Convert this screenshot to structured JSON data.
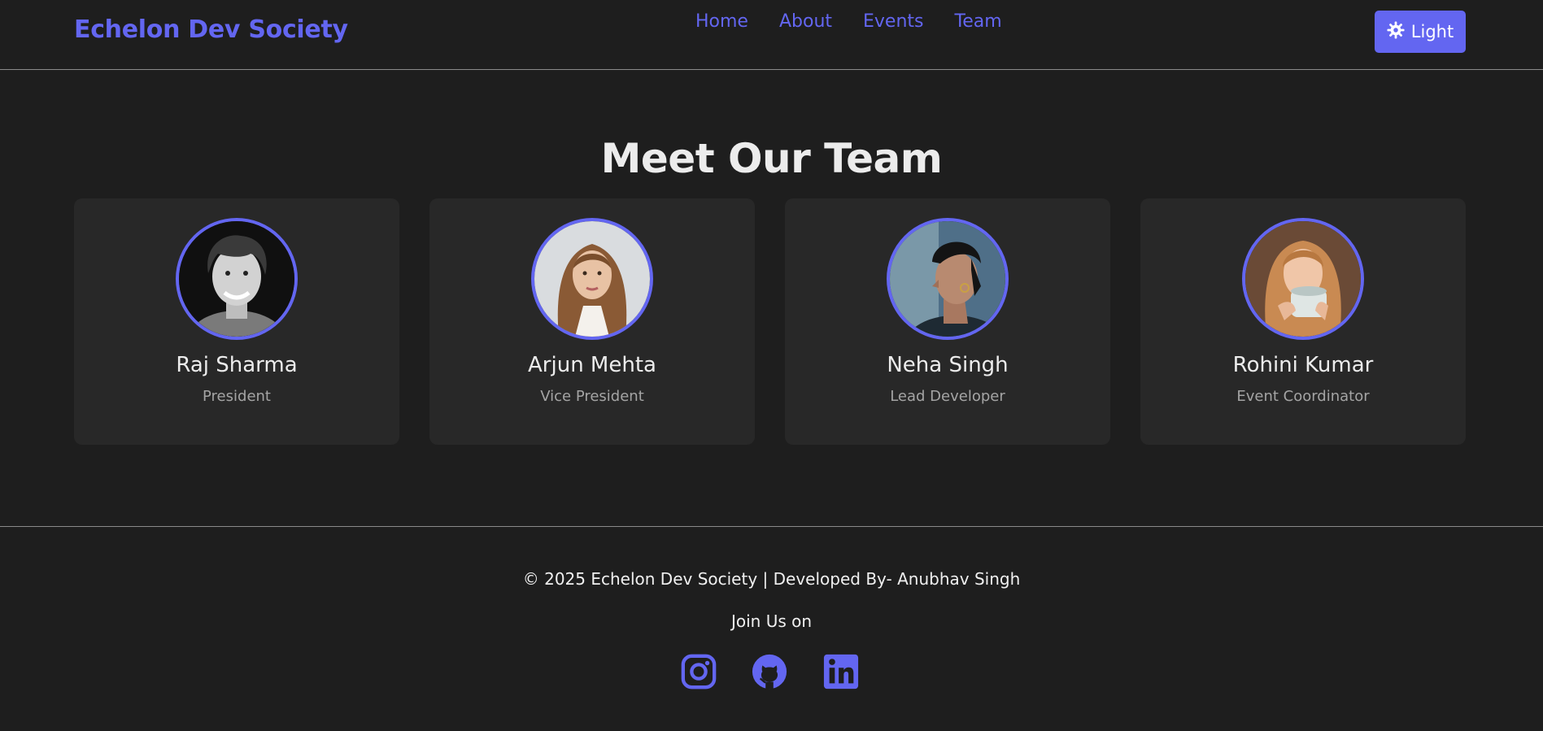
{
  "header": {
    "brand": "Echelon Dev Society",
    "nav": [
      "Home",
      "About",
      "Events",
      "Team"
    ],
    "theme_toggle": {
      "label": "Light",
      "icon": "sun-icon"
    }
  },
  "section": {
    "title": "Meet Our Team"
  },
  "team": [
    {
      "name": "Raj Sharma",
      "role": "President"
    },
    {
      "name": "Arjun Mehta",
      "role": "Vice President"
    },
    {
      "name": "Neha Singh",
      "role": "Lead Developer"
    },
    {
      "name": "Rohini Kumar",
      "role": "Event Coordinator"
    }
  ],
  "footer": {
    "copyright": "© 2025 Echelon Dev Society | Developed By- Anubhav Singh",
    "join_text": "Join Us on",
    "socials": [
      "instagram-icon",
      "github-icon",
      "linkedin-icon"
    ]
  },
  "colors": {
    "accent": "#6366f1",
    "background": "#1e1e1e",
    "card": "#282828",
    "muted_text": "#a4a4a4"
  }
}
